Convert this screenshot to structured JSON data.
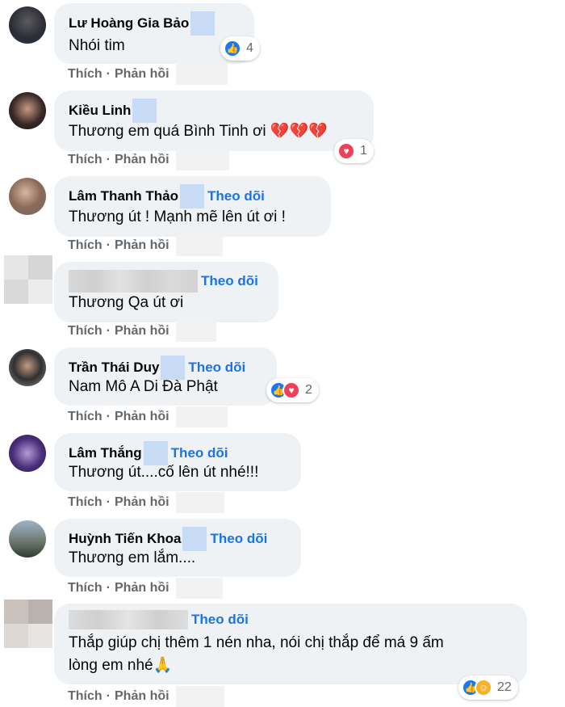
{
  "actions": {
    "like": "Thích",
    "sep": "·",
    "reply": "Phản hồi"
  },
  "comments": [
    {
      "name": "Lư Hoàng Gia Bảo",
      "follow": "",
      "text": "Nhói tim",
      "reaction_count": "4",
      "reactions": [
        "like-icon"
      ]
    },
    {
      "name": "Kiều Linh",
      "follow": "",
      "text": "Thương em quá Bình Tinh ơi 💔💔💔",
      "reaction_count": "1",
      "reactions": [
        "love-icon"
      ]
    },
    {
      "name": "Lâm Thanh Thảo",
      "follow": "Theo dõi",
      "text": "Thương út ! Mạnh mẽ lên út ơi !",
      "reaction_count": "",
      "reactions": []
    },
    {
      "name": "",
      "follow": "Theo dõi",
      "text": "Thương Qa út ơi",
      "reaction_count": "",
      "reactions": []
    },
    {
      "name": "Trần Thái Duy",
      "follow": "Theo dõi",
      "text": "Nam Mô A Di Đà Phật",
      "reaction_count": "2",
      "reactions": [
        "like-icon",
        "love-icon"
      ]
    },
    {
      "name": "Lâm Thắng",
      "follow": "Theo dõi",
      "text": "Thương út....cố lên út nhé!!!",
      "reaction_count": "",
      "reactions": []
    },
    {
      "name": "Huỳnh Tiến Khoa",
      "follow": "Theo dõi",
      "text": "Thương em lắm....",
      "reaction_count": "",
      "reactions": []
    },
    {
      "name": "",
      "follow": "Theo dõi",
      "text_line1": "Thắp giúp chị thêm 1 nén nha, nói chị thắp để má 9 ấm",
      "text_line2": "lòng em nhé🙏",
      "reaction_count": "22",
      "reactions": [
        "like-icon",
        "care-icon"
      ]
    }
  ],
  "colors": {
    "bubble": "#eff2f5",
    "follow": "#1b74e4",
    "action": "#65676b",
    "like": "#1877f2",
    "love": "#f33e58"
  }
}
